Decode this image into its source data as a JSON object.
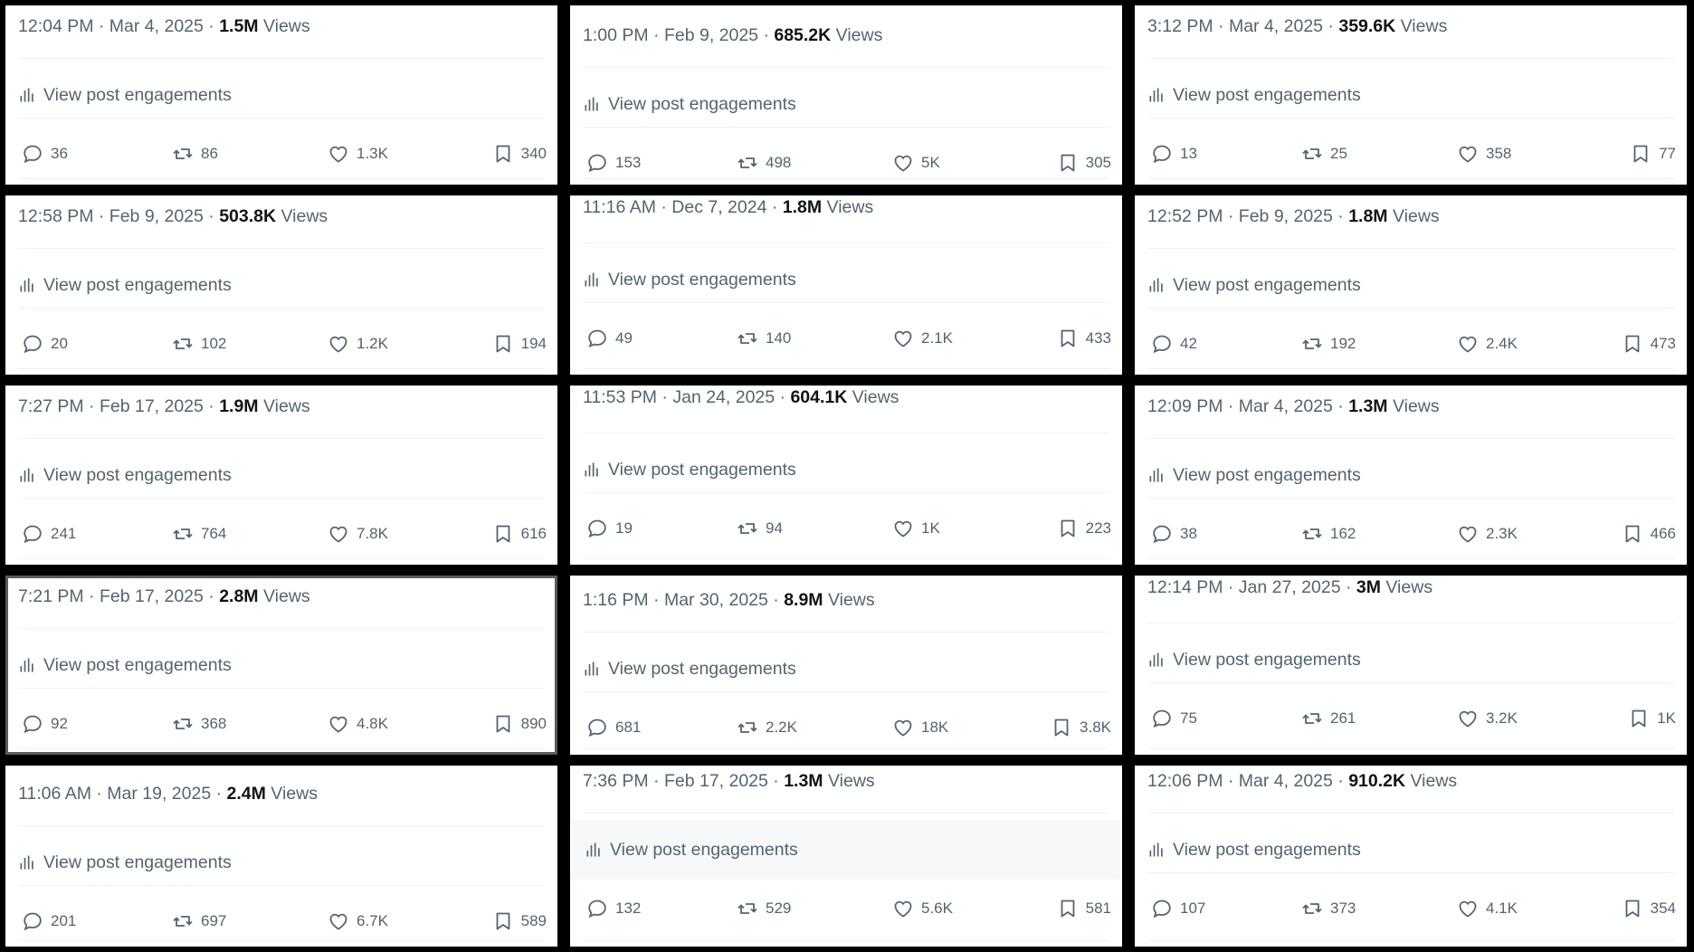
{
  "views_label": "Views",
  "engagements_label": "View post engagements",
  "icons": {
    "reply": "reply-icon",
    "retweet": "retweet-icon",
    "like": "heart-icon",
    "bookmark": "bookmark-icon",
    "engagements": "bar-chart-icon"
  },
  "colors": {
    "muted": "#536471",
    "text": "#0f1419",
    "border": "#eff3f4",
    "background": "#000000"
  },
  "posts": [
    {
      "time": "12:04 PM · Mar 4, 2025 · ",
      "views": "1.5M",
      "replies": "36",
      "reposts": "86",
      "likes": "1.3K",
      "bookmarks": "340"
    },
    {
      "time": "1:00 PM · Feb 9, 2025 · ",
      "views": "685.2K",
      "replies": "153",
      "reposts": "498",
      "likes": "5K",
      "bookmarks": "305"
    },
    {
      "time": "3:12 PM · Mar 4, 2025 · ",
      "views": "359.6K",
      "replies": "13",
      "reposts": "25",
      "likes": "358",
      "bookmarks": "77"
    },
    {
      "time": "12:58 PM · Feb 9, 2025 · ",
      "views": "503.8K",
      "replies": "20",
      "reposts": "102",
      "likes": "1.2K",
      "bookmarks": "194"
    },
    {
      "time": "11:16 AM · Dec 7, 2024 · ",
      "views": "1.8M",
      "replies": "49",
      "reposts": "140",
      "likes": "2.1K",
      "bookmarks": "433"
    },
    {
      "time": "12:52 PM · Feb 9, 2025 · ",
      "views": "1.8M",
      "replies": "42",
      "reposts": "192",
      "likes": "2.4K",
      "bookmarks": "473"
    },
    {
      "time": "7:27 PM · Feb 17, 2025 · ",
      "views": "1.9M",
      "replies": "241",
      "reposts": "764",
      "likes": "7.8K",
      "bookmarks": "616"
    },
    {
      "time": "11:53 PM · Jan 24, 2025 · ",
      "views": "604.1K",
      "replies": "19",
      "reposts": "94",
      "likes": "1K",
      "bookmarks": "223"
    },
    {
      "time": "12:09 PM · Mar 4, 2025 · ",
      "views": "1.3M",
      "replies": "38",
      "reposts": "162",
      "likes": "2.3K",
      "bookmarks": "466"
    },
    {
      "time": "7:21 PM · Feb 17, 2025 · ",
      "views": "2.8M",
      "replies": "92",
      "reposts": "368",
      "likes": "4.8K",
      "bookmarks": "890"
    },
    {
      "time": "1:16 PM · Mar 30, 2025 · ",
      "views": "8.9M",
      "replies": "681",
      "reposts": "2.2K",
      "likes": "18K",
      "bookmarks": "3.8K"
    },
    {
      "time": "12:14 PM · Jan 27, 2025 · ",
      "views": "3M",
      "replies": "75",
      "reposts": "261",
      "likes": "3.2K",
      "bookmarks": "1K"
    },
    {
      "time": "11:06 AM · Mar 19, 2025 · ",
      "views": "2.4M",
      "replies": "201",
      "reposts": "697",
      "likes": "6.7K",
      "bookmarks": "589"
    },
    {
      "time": "7:36 PM · Feb 17, 2025 · ",
      "views": "1.3M",
      "replies": "132",
      "reposts": "529",
      "likes": "5.6K",
      "bookmarks": "581"
    },
    {
      "time": "12:06 PM · Mar 4, 2025 · ",
      "views": "910.2K",
      "replies": "107",
      "reposts": "373",
      "likes": "4.1K",
      "bookmarks": "354"
    }
  ]
}
